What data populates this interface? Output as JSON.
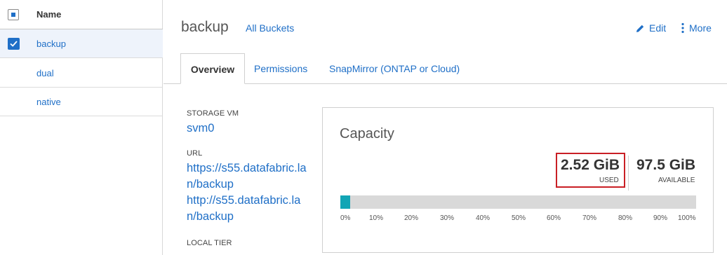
{
  "list": {
    "header": "Name",
    "rows": [
      {
        "label": "backup",
        "selected": true
      },
      {
        "label": "dual",
        "selected": false
      },
      {
        "label": "native",
        "selected": false
      }
    ]
  },
  "bucket": {
    "title": "backup",
    "all_buckets_link": "All Buckets"
  },
  "actions": {
    "edit": "Edit",
    "more": "More"
  },
  "tabs": [
    "Overview",
    "Permissions",
    "SnapMirror (ONTAP or Cloud)"
  ],
  "details": {
    "storage_vm_label": "STORAGE VM",
    "storage_vm_value": "svm0",
    "url_label": "URL",
    "url_https": "https://s55.datafabric.lan/backup",
    "url_http": "http://s55.datafabric.lan/backup",
    "local_tier_label": "LOCAL TIER"
  },
  "capacity": {
    "title": "Capacity",
    "used_value": "2.52 GiB",
    "used_label": "USED",
    "available_value": "97.5 GiB",
    "available_label": "AVAILABLE",
    "used_fraction": 0.025,
    "ticks": [
      "0%",
      "10%",
      "20%",
      "30%",
      "40%",
      "50%",
      "60%",
      "70%",
      "80%",
      "90%",
      "100%"
    ]
  },
  "colors": {
    "link": "#1f6fc7",
    "bar_fill": "#12a5b5",
    "bar_track": "#d9d9d9",
    "highlight": "#c91f25"
  }
}
